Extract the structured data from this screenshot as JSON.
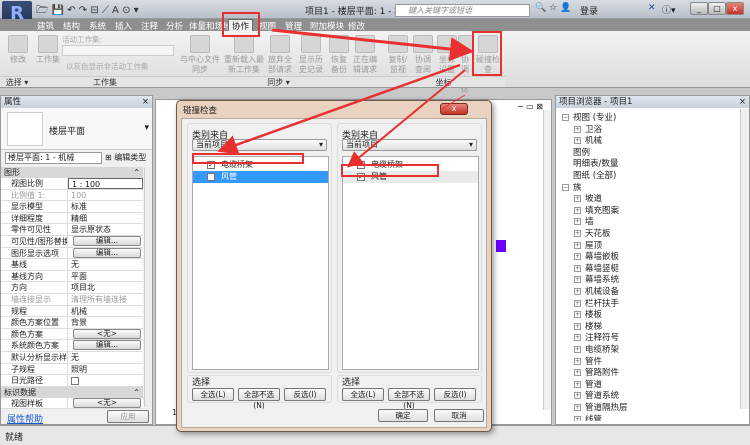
{
  "app": {
    "title": "项目1 - 楼层平面: 1 - 机械",
    "search_placeholder": "键入关键字或短语",
    "login": "登录",
    "logo": "R"
  },
  "tabs": [
    "建筑",
    "结构",
    "系统",
    "插入",
    "注释",
    "分析",
    "体量和场地",
    "协作",
    "视图",
    "管理",
    "附加模块",
    "修改"
  ],
  "ribbon": {
    "modify": "修改",
    "worksets": "工作集",
    "active_workset_label": "活动工作集:",
    "gray_inactive": "以灰色显示非活动工作集",
    "sync": [
      "与中心文件同步",
      "重新载入最新工作集",
      "放弃全部请求",
      "显示历史记录",
      "恢复备份",
      "正在编辑请求"
    ],
    "coord": [
      "复制/监视",
      "协调查阅",
      "坐标设置",
      "协调主体",
      "碰撞检查"
    ],
    "panels": {
      "select": "选择 ▾",
      "worksets": "工作集",
      "sync": "同步 ▾",
      "coord": "坐标"
    }
  },
  "properties": {
    "title": "属性",
    "type_name": "楼层平面",
    "instance": "楼层平面: 1 - 机械",
    "edit_type": "编辑类型",
    "sections": {
      "graphics": "图形",
      "identity": "标识数据"
    },
    "rows": [
      [
        "视图比例",
        "1 : 100"
      ],
      [
        "比例值 1:",
        "100"
      ],
      [
        "显示模型",
        "标准"
      ],
      [
        "详细程度",
        "精细"
      ],
      [
        "零件可见性",
        "显示原状态"
      ],
      [
        "可见性/图形替换",
        "编辑..."
      ],
      [
        "图形显示选项",
        "编辑..."
      ],
      [
        "基线",
        "无"
      ],
      [
        "基线方向",
        "平面"
      ],
      [
        "方向",
        "项目北"
      ],
      [
        "墙连接显示",
        "清理所有墙连接"
      ],
      [
        "规程",
        "机械"
      ],
      [
        "颜色方案位置",
        "背景"
      ],
      [
        "颜色方案",
        "<无>"
      ],
      [
        "系统颜色方案",
        "编辑..."
      ],
      [
        "默认分析显示样式",
        "无"
      ],
      [
        "子规程",
        "照明"
      ],
      [
        "日光路径",
        ""
      ]
    ],
    "view_template": [
      "视图样板",
      "<无>"
    ],
    "help": "属性帮助",
    "apply": "应用"
  },
  "browser": {
    "title": "项目浏览器 - 项目1",
    "items": [
      [
        "−",
        "视图 (专业)",
        0
      ],
      [
        "+",
        "卫浴",
        1
      ],
      [
        "+",
        "机械",
        1
      ],
      [
        "",
        "图例",
        0
      ],
      [
        "",
        "明细表/数量",
        0
      ],
      [
        "",
        "图纸 (全部)",
        0
      ],
      [
        "−",
        "族",
        0
      ],
      [
        "+",
        "坡道",
        1
      ],
      [
        "+",
        "填充图案",
        1
      ],
      [
        "+",
        "墙",
        1
      ],
      [
        "+",
        "天花板",
        1
      ],
      [
        "+",
        "屋顶",
        1
      ],
      [
        "+",
        "幕墙嵌板",
        1
      ],
      [
        "+",
        "幕墙竖梃",
        1
      ],
      [
        "+",
        "幕墙系统",
        1
      ],
      [
        "+",
        "机械设备",
        1
      ],
      [
        "+",
        "栏杆扶手",
        1
      ],
      [
        "+",
        "楼板",
        1
      ],
      [
        "+",
        "楼梯",
        1
      ],
      [
        "+",
        "注释符号",
        1
      ],
      [
        "+",
        "电缆桥架",
        1
      ],
      [
        "+",
        "管件",
        1
      ],
      [
        "+",
        "管路附件",
        1
      ],
      [
        "+",
        "管道",
        1
      ],
      [
        "+",
        "管道系统",
        1
      ],
      [
        "+",
        "管道隔热层",
        1
      ],
      [
        "+",
        "线管",
        1
      ]
    ]
  },
  "status": {
    "text": "就绪",
    "scale": "1"
  },
  "dialog": {
    "title": "碰撞检查",
    "close": "x",
    "left": {
      "from_label": "类别来自",
      "from_value": "当前项目",
      "items": [
        {
          "label": "电缆桥架",
          "checked": true
        },
        {
          "label": "风管",
          "checked": false
        }
      ]
    },
    "right": {
      "from_label": "类别来自",
      "from_value": "当前项目",
      "items": [
        {
          "label": "电缆桥架",
          "checked": false
        },
        {
          "label": "风管",
          "checked": true
        }
      ]
    },
    "select_label": "选择",
    "select_all": "全选(L)",
    "select_none": "全部不选(N)",
    "invert": "反选(I)",
    "ok": "确定",
    "cancel": "取消"
  },
  "colors": {
    "accent": "#3399ff",
    "annotation": "#e83030",
    "element": "#6a00ff"
  }
}
